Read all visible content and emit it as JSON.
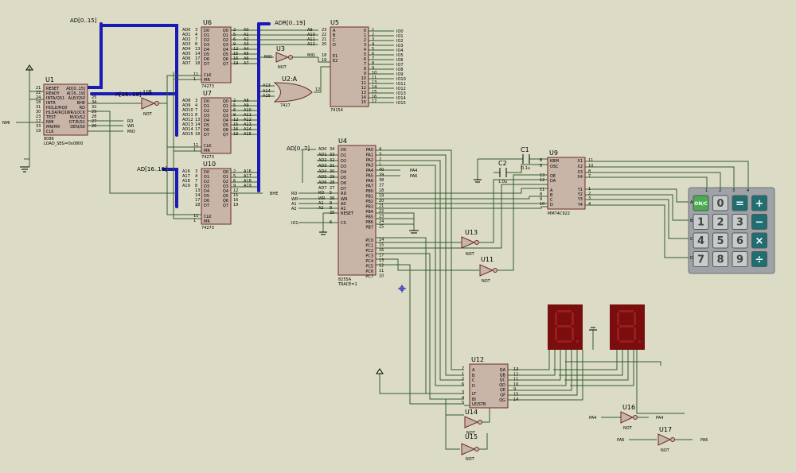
{
  "chips": {
    "u1": {
      "ref": "U1",
      "part": "8086",
      "prop": "LOAD_SEG=0x0800",
      "left_pins": [
        "RESET",
        "READY",
        "INTA/QS1",
        "INTR",
        "HOLD/RQ0",
        "HLDA/RQ1",
        "TEST",
        "NMI",
        "MN/MX",
        "CLK"
      ],
      "left_nums": [
        "21",
        "22",
        "24",
        "18",
        "31",
        "30",
        "23",
        "17",
        "33",
        "19"
      ],
      "right_pins": [
        "AD[0..15]",
        "A[16..19]",
        "ALE/QS0",
        "BHE",
        "RD",
        "WR/LOCK",
        "M/IO/S2",
        "DT/R/S1",
        "DEN/S0"
      ],
      "right_nums": [
        "",
        "",
        "25",
        "34",
        "32",
        "29",
        "28",
        "27",
        "26"
      ]
    },
    "u6": {
      "ref": "U6",
      "part": "74273",
      "inputs": [
        "D0",
        "D1",
        "D2",
        "D3",
        "D4",
        "D5",
        "D6",
        "D7"
      ],
      "outputs": [
        "Q0",
        "Q1",
        "Q2",
        "Q3",
        "Q4",
        "Q5",
        "Q6",
        "Q7"
      ],
      "in_nets": [
        "AD0",
        "AD1",
        "AD2",
        "AD3",
        "AD4",
        "AD5",
        "AD6",
        "AD7"
      ],
      "out_nets": [
        "A0",
        "A1",
        "A2",
        "A3",
        "A4",
        "A5",
        "A6",
        "A7"
      ],
      "in_nums": [
        "3",
        "4",
        "7",
        "8",
        "13",
        "14",
        "17",
        "18"
      ],
      "out_nums": [
        "2",
        "5",
        "6",
        "9",
        "12",
        "15",
        "16",
        "19"
      ]
    },
    "u7": {
      "ref": "U7",
      "part": "74273",
      "inputs": [
        "D0",
        "D1",
        "D2",
        "D3",
        "D4",
        "D5",
        "D6",
        "D7"
      ],
      "outputs": [
        "Q0",
        "Q1",
        "Q2",
        "Q3",
        "Q4",
        "Q5",
        "Q6",
        "Q7"
      ],
      "in_nets": [
        "AD8",
        "AD9",
        "AD10",
        "AD11",
        "AD12",
        "AD13",
        "AD14",
        "AD15"
      ],
      "out_nets": [
        "A8",
        "A9",
        "A10",
        "A11",
        "A12",
        "A13",
        "A14",
        "A15"
      ],
      "in_nums": [
        "3",
        "4",
        "7",
        "8",
        "13",
        "14",
        "17",
        "18"
      ],
      "out_nums": [
        "2",
        "5",
        "6",
        "9",
        "12",
        "15",
        "16",
        "19"
      ]
    },
    "u10": {
      "ref": "U10",
      "part": "74273",
      "inputs": [
        "D0",
        "D1",
        "D2",
        "D3",
        "D4",
        "D5",
        "D6",
        "D7"
      ],
      "outputs": [
        "Q0",
        "Q1",
        "Q2",
        "Q3",
        "Q4",
        "Q5",
        "Q6",
        "Q7"
      ],
      "in_nets": [
        "A16",
        "A17",
        "A18",
        "A19",
        "",
        "",
        "",
        ""
      ],
      "out_nets": [
        "A16",
        "A17",
        "A18",
        "A19",
        "",
        "",
        "",
        ""
      ],
      "in_nums": [
        "3",
        "4",
        "7",
        "8",
        "13",
        "14",
        "17",
        "18"
      ],
      "out_nums": [
        "2",
        "5",
        "6",
        "9",
        "12",
        "15",
        "16",
        "19"
      ]
    },
    "u5": {
      "ref": "U5",
      "part": "74154",
      "inputs": [
        "A",
        "B",
        "C",
        "D",
        "E1",
        "E2"
      ],
      "in_nets": [
        "A9",
        "A10",
        "A11",
        "A12",
        "MIO",
        ""
      ],
      "in_nums": [
        "23",
        "22",
        "21",
        "20",
        "18",
        "19"
      ],
      "outputs": [
        "0",
        "1",
        "2",
        "3",
        "4",
        "5",
        "6",
        "7",
        "8",
        "9",
        "10",
        "11",
        "12",
        "13",
        "14",
        "15"
      ],
      "out_nums": [
        "1",
        "2",
        "3",
        "4",
        "5",
        "6",
        "7",
        "8",
        "9",
        "10",
        "11",
        "13",
        "14",
        "15",
        "16",
        "17"
      ],
      "out_nets": [
        "IO0",
        "IO1",
        "IO2",
        "IO3",
        "IO4",
        "IO5",
        "IO6",
        "IO7",
        "IO8",
        "IO9",
        "IO10",
        "IO11",
        "IO12",
        "IO13",
        "IO14",
        "IO15"
      ]
    },
    "u4": {
      "ref": "U4",
      "part": "8255A",
      "prop": "TRACE=1",
      "left_pins": [
        "D0",
        "D1",
        "D2",
        "D3",
        "D4",
        "D5",
        "D6",
        "D7",
        "RD",
        "WR",
        "A0",
        "A1",
        "RESET",
        "CS"
      ],
      "left_nets": [
        "AD0",
        "AD1",
        "AD2",
        "AD3",
        "AD4",
        "AD5",
        "AD6",
        "AD7",
        "RD",
        "WR",
        "A1",
        "A2",
        "",
        ""
      ],
      "left_nums": [
        "34",
        "33",
        "32",
        "31",
        "30",
        "29",
        "28",
        "27",
        "5",
        "36",
        "9",
        "8",
        "35",
        "6"
      ],
      "right_pins": [
        "PA0",
        "PA1",
        "PA2",
        "PA3",
        "PA4",
        "PA5",
        "PA6",
        "PA7",
        "PB0",
        "PB1",
        "PB2",
        "PB3",
        "PB4",
        "PB5",
        "PB6",
        "PB7",
        "PC0",
        "PC1",
        "PC2",
        "PC3",
        "PC4",
        "PC5",
        "PC6",
        "PC7"
      ],
      "right_nums": [
        "4",
        "3",
        "2",
        "1",
        "40",
        "39",
        "38",
        "37",
        "18",
        "19",
        "20",
        "21",
        "22",
        "23",
        "24",
        "25",
        "14",
        "15",
        "16",
        "17",
        "13",
        "12",
        "11",
        "10"
      ]
    },
    "u9": {
      "ref": "U9",
      "part": "MM74C922",
      "left_pins": [
        "KBM",
        "OSC",
        "OE",
        "DA",
        "A",
        "B",
        "C",
        "D"
      ],
      "left_nums": [
        "6",
        "5",
        "13",
        "12",
        "11",
        "8",
        "9",
        "10"
      ],
      "right_pins": [
        "X1",
        "X2",
        "X3",
        "X4",
        "Y1",
        "Y2",
        "Y3",
        "Y4"
      ],
      "right_nums": [
        "11",
        "10",
        "8",
        "7",
        "1",
        "2",
        "3",
        "4"
      ]
    },
    "u12": {
      "ref": "U12",
      "part": "",
      "left_pins": [
        "A",
        "B",
        "C",
        "D",
        "LT",
        "BI",
        "LE/STB"
      ],
      "left_nums": [
        "7",
        "1",
        "2",
        "6",
        "3",
        "4",
        "5"
      ],
      "right_pins": [
        "QA",
        "QB",
        "QC",
        "QD",
        "QE",
        "QF",
        "QG"
      ],
      "right_nums": [
        "13",
        "12",
        "11",
        "10",
        "9",
        "15",
        "14"
      ]
    }
  },
  "gates": {
    "u8": {
      "ref": "U8",
      "type": "NOT"
    },
    "u3": {
      "ref": "U3",
      "type": "NOT",
      "input": "MIO"
    },
    "u2a": {
      "ref": "U2:A",
      "part": "7427",
      "pins": [
        "13",
        "1",
        "2",
        "12"
      ],
      "inputs": [
        "A13",
        "A14",
        "A15"
      ]
    },
    "u13": {
      "ref": "U13",
      "type": "NOT"
    },
    "u11": {
      "ref": "U11",
      "type": "NOT"
    },
    "u14": {
      "ref": "U14",
      "type": "NOT"
    },
    "u15": {
      "ref": "U15",
      "type": "NOT"
    },
    "u16": {
      "ref": "U16",
      "type": "NOT",
      "in": "PA4",
      "out": "PA4"
    },
    "u17": {
      "ref": "U17",
      "type": "NOT",
      "in": "PA6",
      "out": "PA6"
    }
  },
  "caps": {
    "c1": {
      "ref": "C1",
      "value": "0.1u"
    },
    "c2": {
      "ref": "C2",
      "value": "1.0u"
    }
  },
  "buses": {
    "ad_top": "AD[0..15]",
    "adr": "ADR[0..19]",
    "a_top": "A[16..19]",
    "ad_mid": "AD[16..19]",
    "ad_u4": "AD[0..7]"
  },
  "nets": {
    "nmi": "NMI",
    "rd": "RD",
    "wr": "WR",
    "mio": "MIO",
    "bhe": "BHE",
    "io1": "IO1",
    "a1": "A1",
    "a2": "A2",
    "pa4": "PA4",
    "pa6": "PA6"
  },
  "keypad": {
    "cols": [
      "1",
      "2",
      "3",
      "4"
    ],
    "rows": [
      "A",
      "B",
      "C",
      "D"
    ],
    "keys": [
      {
        "label": "ON/C",
        "type": "on"
      },
      {
        "label": "0",
        "type": "num"
      },
      {
        "label": "=",
        "type": "op"
      },
      {
        "label": "+",
        "type": "op"
      },
      {
        "label": "1",
        "type": "num"
      },
      {
        "label": "2",
        "type": "num"
      },
      {
        "label": "3",
        "type": "num"
      },
      {
        "label": "−",
        "type": "op"
      },
      {
        "label": "4",
        "type": "num"
      },
      {
        "label": "5",
        "type": "num"
      },
      {
        "label": "6",
        "type": "num"
      },
      {
        "label": "×",
        "type": "op"
      },
      {
        "label": "7",
        "type": "num"
      },
      {
        "label": "8",
        "type": "num"
      },
      {
        "label": "9",
        "type": "num"
      },
      {
        "label": "÷",
        "type": "op"
      }
    ]
  },
  "colors": {
    "wire": "#2f5b2f",
    "bus": "#1a1ab4",
    "chip": "#c9b4a8",
    "seg_body": "#7a0d0d",
    "seg_off": "#9a1c1c",
    "keypad_frame": "#9da3a6",
    "key_num": "#c8cbcc",
    "key_op": "#1f6e72",
    "key_on": "#4caa52"
  }
}
